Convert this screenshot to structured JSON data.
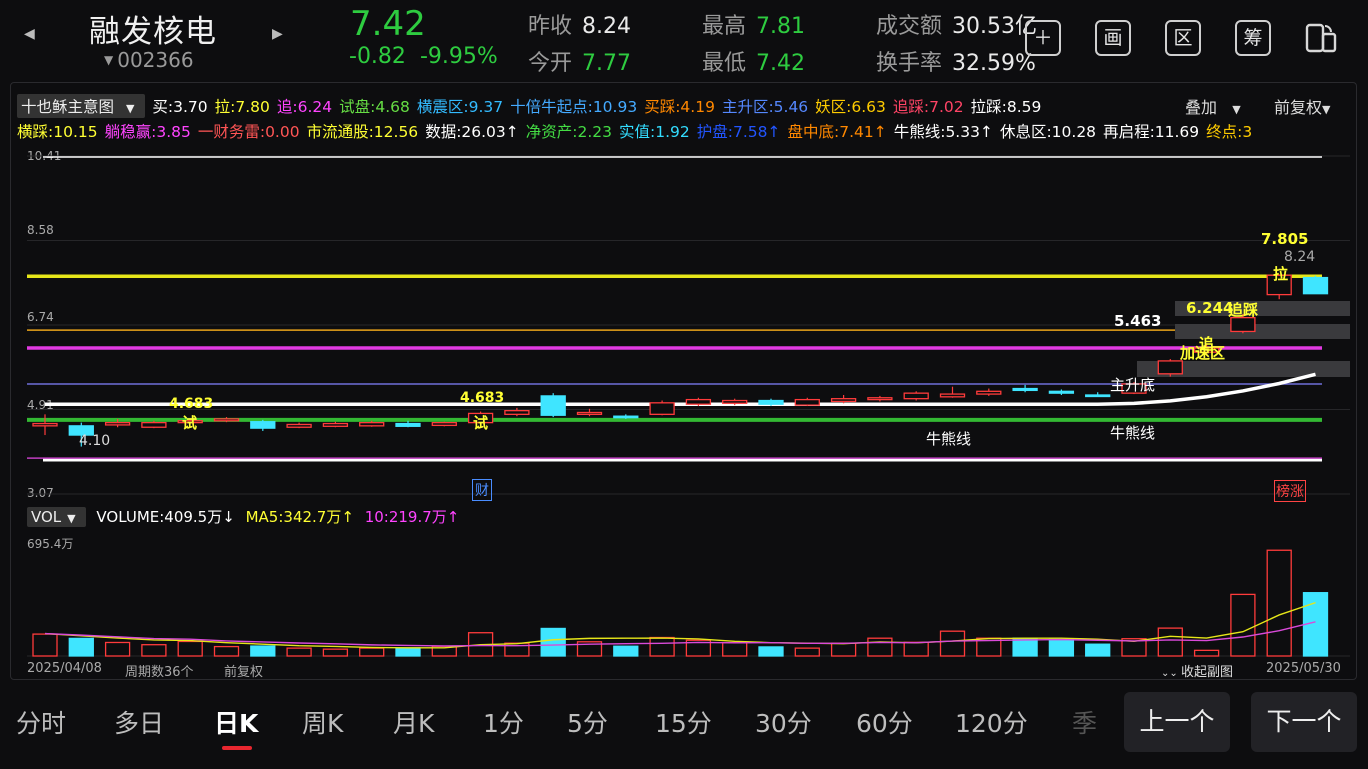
{
  "header": {
    "stock_name": "融发核电",
    "stock_code": "002366",
    "price": "7.42",
    "change": "-0.82",
    "change_pct": "-9.95%",
    "prev_close_label": "昨收",
    "prev_close": "8.24",
    "open_label": "今开",
    "open": "7.77",
    "high_label": "最高",
    "high": "7.81",
    "low_label": "最低",
    "low": "7.42",
    "turnover_label": "成交额",
    "turnover": "30.53亿",
    "turnover_rate_label": "换手率",
    "turnover_rate": "32.59%",
    "icons": [
      "plus-icon",
      "画",
      "区",
      "筹",
      "phone-switch-icon"
    ],
    "icon_labels": {
      "draw": "画",
      "zone": "区",
      "chips": "筹"
    }
  },
  "indicator": {
    "name": "十也稣主意图",
    "row1": [
      {
        "text": "买:3.70",
        "color": "#ffffff"
      },
      {
        "text": "拉:7.80",
        "color": "#ffff33"
      },
      {
        "text": "追:6.24",
        "color": "#ff44ff"
      },
      {
        "text": "试盘:4.68",
        "color": "#66dd44"
      },
      {
        "text": "横震区:9.37",
        "color": "#33bbff"
      },
      {
        "text": "十倍牛起点:10.93",
        "color": "#44aaff"
      },
      {
        "text": "买踩:4.19",
        "color": "#ff8800"
      },
      {
        "text": "主升区:5.46",
        "color": "#5588ff"
      },
      {
        "text": "妖区:6.63",
        "color": "#ffcc00"
      },
      {
        "text": "追踩:7.02",
        "color": "#ff4466"
      },
      {
        "text": "拉踩:8.59",
        "color": "#ffffff"
      }
    ],
    "row2": [
      {
        "text": "横踩:10.15",
        "color": "#ffff33"
      },
      {
        "text": "躺稳赢:3.85",
        "color": "#ff44ff"
      },
      {
        "text": "一财务雷:0.00",
        "color": "#ff5555"
      },
      {
        "text": "市流通股:12.56",
        "color": "#ffff33"
      },
      {
        "text": "数据:26.03↑",
        "color": "#ffffff"
      },
      {
        "text": "净资产:2.23",
        "color": "#44dd44"
      },
      {
        "text": "实值:1.92",
        "color": "#33ddff"
      },
      {
        "text": "护盘:7.58↑",
        "color": "#2255ff"
      },
      {
        "text": "盘中底:7.41↑",
        "color": "#ff8800"
      },
      {
        "text": "牛熊线:5.33↑",
        "color": "#ffffff"
      },
      {
        "text": "休息区:10.28",
        "color": "#ffffff"
      },
      {
        "text": "再启程:11.69",
        "color": "#ffffff"
      },
      {
        "text": "终点:3",
        "color": "#ffcc00"
      }
    ],
    "overlay_label": "叠加",
    "adjust_label": "前复权"
  },
  "chart_data": {
    "type": "candlestick",
    "y_ticks": [
      "10.41",
      "8.58",
      "6.74",
      "4.91",
      "3.07"
    ],
    "ylim": [
      3.07,
      10.41
    ],
    "annotations": {
      "high_label": "7.805",
      "last_label": "8.24",
      "la": "拉",
      "zhuicai": "追踩",
      "zhui_value": "6.244",
      "zhui": "追",
      "jiasu": "加速区",
      "zhusheng_value": "5.463",
      "zhushengdi": "主升底",
      "niuxiong1": "牛熊线",
      "niuxiong2": "牛熊线",
      "shi_value1": "4.683",
      "shi1": "试",
      "shi_value2": "4.683",
      "shi2": "试",
      "low_label": "4.10",
      "cai": "财",
      "bangzhang": "榜涨"
    },
    "lines": [
      {
        "name": "拉",
        "value": 7.8,
        "color": "#e6e619"
      },
      {
        "name": "妖区",
        "value": 6.63,
        "color": "#e8a31a"
      },
      {
        "name": "追",
        "value": 6.24,
        "color": "#e23ae2"
      },
      {
        "name": "主升区",
        "value": 5.46,
        "color": "#6f6fd8"
      },
      {
        "name": "试盘",
        "value": 4.68,
        "color": "#33b833"
      },
      {
        "name": "躺稳赢",
        "value": 3.85,
        "color": "#c03fc0"
      },
      {
        "name": "买",
        "value": 3.7,
        "color": "#ffffff"
      }
    ],
    "candles": [
      [
        4.55,
        4.6,
        4.8,
        4.35
      ],
      [
        4.55,
        4.35,
        4.62,
        4.1
      ],
      [
        4.57,
        4.62,
        4.7,
        4.52
      ],
      [
        4.52,
        4.62,
        4.66,
        4.5
      ],
      [
        4.62,
        4.66,
        4.72,
        4.6
      ],
      [
        4.66,
        4.7,
        4.74,
        4.63
      ],
      [
        4.64,
        4.5,
        4.68,
        4.44
      ],
      [
        4.52,
        4.58,
        4.62,
        4.5
      ],
      [
        4.54,
        4.6,
        4.64,
        4.52
      ],
      [
        4.55,
        4.62,
        4.66,
        4.53
      ],
      [
        4.6,
        4.54,
        4.66,
        4.52
      ],
      [
        4.56,
        4.62,
        4.64,
        4.54
      ],
      [
        4.62,
        4.82,
        4.86,
        4.6
      ],
      [
        4.8,
        4.88,
        4.94,
        4.76
      ],
      [
        5.2,
        4.78,
        5.26,
        4.74
      ],
      [
        4.8,
        4.84,
        4.92,
        4.76
      ],
      [
        4.76,
        4.74,
        4.8,
        4.7
      ],
      [
        4.8,
        5.05,
        5.1,
        4.78
      ],
      [
        5.02,
        5.12,
        5.16,
        4.98
      ],
      [
        5.04,
        5.1,
        5.14,
        5.0
      ],
      [
        5.1,
        5.02,
        5.14,
        4.98
      ],
      [
        5.0,
        5.12,
        5.16,
        4.98
      ],
      [
        5.08,
        5.14,
        5.22,
        5.04
      ],
      [
        5.12,
        5.16,
        5.2,
        5.08
      ],
      [
        5.14,
        5.26,
        5.3,
        5.1
      ],
      [
        5.18,
        5.24,
        5.4,
        5.16
      ],
      [
        5.24,
        5.3,
        5.36,
        5.2
      ],
      [
        5.36,
        5.32,
        5.44,
        5.28
      ],
      [
        5.3,
        5.26,
        5.34,
        5.22
      ],
      [
        5.22,
        5.2,
        5.28,
        5.18
      ],
      [
        5.26,
        5.46,
        5.5,
        5.24
      ],
      [
        5.68,
        5.96,
        6.0,
        5.62
      ],
      [
        6.15,
        6.24,
        6.32,
        6.1
      ],
      [
        6.6,
        6.9,
        6.98,
        6.56
      ],
      [
        7.4,
        7.82,
        7.84,
        7.3
      ],
      [
        7.77,
        7.42,
        7.81,
        7.42
      ]
    ],
    "volume_ylabel": "695.4万",
    "volumes": [
      128,
      103,
      79,
      66,
      85,
      55,
      58,
      46,
      40,
      46,
      47,
      57,
      136,
      75,
      161,
      83,
      57,
      108,
      92,
      78,
      53,
      46,
      75,
      104,
      80,
      145,
      104,
      104,
      97,
      69,
      101,
      163,
      33,
      360,
      618,
      370
    ],
    "ma5": [
      131,
      118,
      105,
      94,
      90,
      78,
      69,
      60,
      56,
      50,
      48,
      48,
      66,
      72,
      95,
      103,
      104,
      105,
      100,
      86,
      78,
      75,
      72,
      82,
      77,
      87,
      102,
      104,
      104,
      98,
      86,
      115,
      105,
      142,
      240,
      312
    ],
    "ma10": [
      131,
      122,
      112,
      102,
      98,
      88,
      82,
      76,
      71,
      65,
      62,
      59,
      61,
      60,
      64,
      69,
      72,
      74,
      79,
      77,
      78,
      74,
      74,
      79,
      78,
      87,
      90,
      94,
      96,
      92,
      88,
      94,
      90,
      111,
      148,
      200
    ],
    "volume_max": 695.4
  },
  "volume_bar": {
    "selector": "VOL",
    "volume": "VOLUME:409.5万↓",
    "ma5": "MA5:342.7万↑",
    "ma10": "10:219.7万↑"
  },
  "footer": {
    "start_date": "2025/04/08",
    "period_count": "周期数36个",
    "adjust": "前复权",
    "collapse": "收起副图",
    "end_date": "2025/05/30"
  },
  "tabs": [
    "分时",
    "多日",
    "日K",
    "周K",
    "月K",
    "1分",
    "5分",
    "15分",
    "30分",
    "60分",
    "120分",
    "季"
  ],
  "active_tab": "日K",
  "prev_button": "上一个",
  "next_button": "下一个"
}
